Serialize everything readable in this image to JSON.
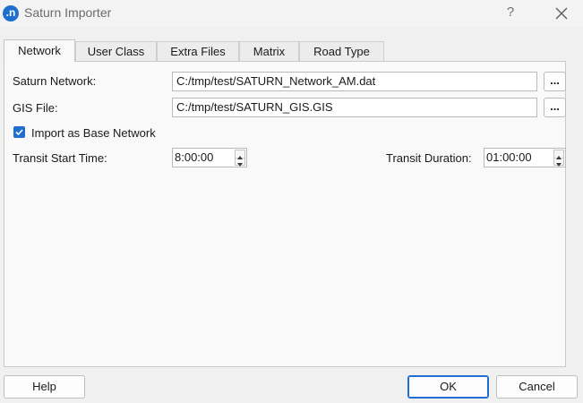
{
  "window": {
    "title": "Saturn Importer",
    "app_icon_glyph": ".n",
    "help_glyph": "?"
  },
  "tabs": [
    {
      "label": "Network",
      "active": true
    },
    {
      "label": "User Class",
      "active": false
    },
    {
      "label": "Extra Files",
      "active": false
    },
    {
      "label": "Matrix",
      "active": false
    },
    {
      "label": "Road Type",
      "active": false
    }
  ],
  "network": {
    "saturn_network_label": "Saturn Network:",
    "saturn_network_value": "C:/tmp/test/SATURN_Network_AM.dat",
    "gis_file_label": "GIS File:",
    "gis_file_value": "C:/tmp/test/SATURN_GIS.GIS",
    "browse_label": "...",
    "import_base_label": "Import as Base Network",
    "import_base_checked": true,
    "transit_start_label": "Transit Start Time:",
    "transit_start_value": "8:00:00",
    "transit_duration_label": "Transit Duration:",
    "transit_duration_value": "01:00:00"
  },
  "buttons": {
    "help": "Help",
    "ok": "OK",
    "cancel": "Cancel"
  },
  "colors": {
    "accent": "#1f6fd1",
    "background": "#f0f0f0",
    "panel": "#f9f9f9"
  }
}
